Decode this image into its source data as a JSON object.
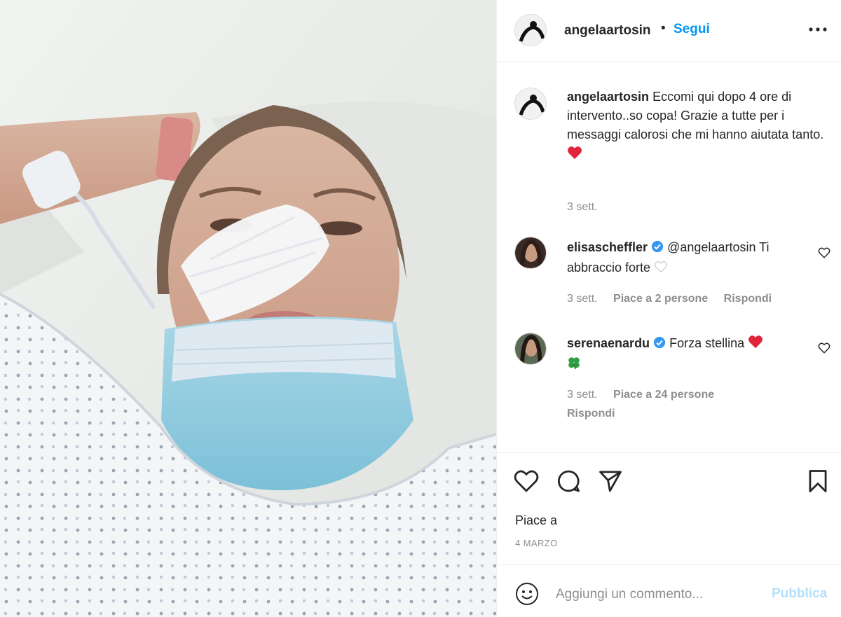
{
  "post": {
    "author": "angelaartosin",
    "separator": "•",
    "follow_label": "Segui",
    "more_icon": "more-horizontal-icon"
  },
  "caption": {
    "username": "angelaartosin",
    "text": "Eccomi qui dopo 4 ore di intervento..so copa! Grazie a tutte per i messaggi calorosi che mi hanno aiutata tanto.",
    "emoji": "❤️",
    "time": "3 sett."
  },
  "comments": [
    {
      "username": "elisascheffler",
      "verified": true,
      "text": "@angelaartosin Ti abbraccio forte",
      "emoji": "🤍",
      "time": "3 sett.",
      "likes": "Piace a 2 persone",
      "reply": "Rispondi"
    },
    {
      "username": "serenaenardu",
      "verified": true,
      "text": "Forza stellina",
      "emoji": "❤️",
      "emoji2": "🍀",
      "time": "3 sett.",
      "likes": "Piace a 24 persone",
      "reply": "Rispondi"
    }
  ],
  "actions": {
    "likes_label": "Piace a",
    "date": "4 MARZO"
  },
  "add_comment": {
    "placeholder": "Aggiungi un commento...",
    "publish_label": "Pubblica"
  },
  "colors": {
    "link_blue": "#0095f6",
    "publish_disabled": "#b2dffc",
    "heart_red": "#ed4956",
    "verified_blue": "#3897f0",
    "secondary_text": "#8e8e8e"
  }
}
